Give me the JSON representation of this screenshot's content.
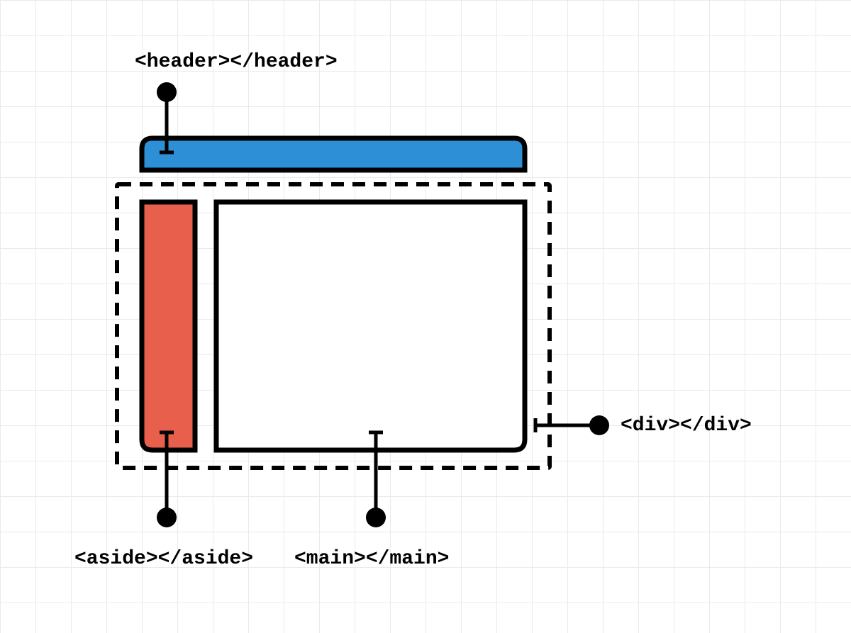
{
  "labels": {
    "header": "<header></header>",
    "aside": "<aside></aside>",
    "main": "<main></main>",
    "div": "<div></div>"
  },
  "colors": {
    "header_fill": "#2d8fd5",
    "aside_fill": "#e8604c",
    "main_fill": "#ffffff",
    "stroke": "#000000"
  }
}
